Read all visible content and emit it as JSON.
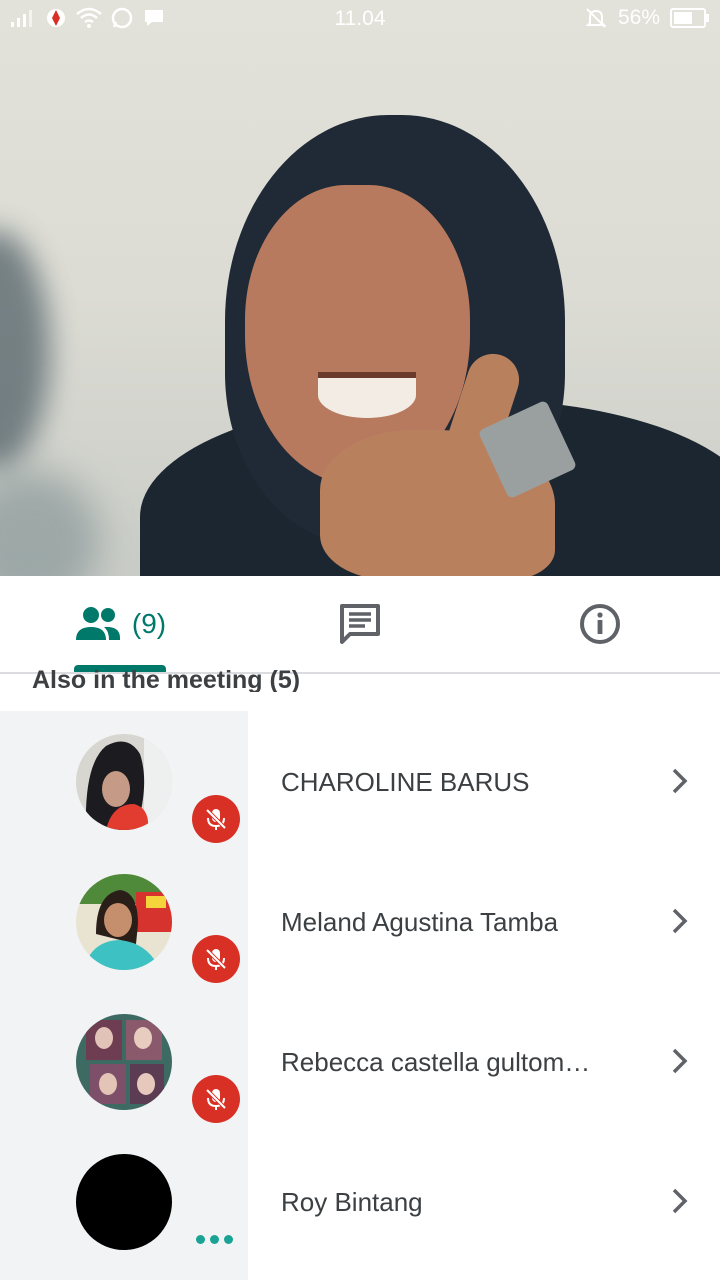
{
  "status_bar": {
    "time": "11.04",
    "battery": "56%",
    "icons": [
      "signal-icon",
      "telkom-icon",
      "wifi-icon",
      "whatsapp-icon",
      "chat-notification-icon",
      "mute-bell-icon",
      "battery-icon"
    ]
  },
  "video": {
    "description_icon": "participant-video"
  },
  "tabs": {
    "people_count": "(9)",
    "people_icon": "people-icon",
    "chat_icon": "chat-icon",
    "info_icon": "info-icon",
    "accent": "#00796b"
  },
  "section": {
    "title": "Also in the meeting (5)"
  },
  "participants": [
    {
      "name": "CHAROLINE BARUS",
      "status": "muted"
    },
    {
      "name": "Meland Agustina Tamba",
      "status": "muted"
    },
    {
      "name": "Rebecca castella gultom…",
      "status": "muted"
    },
    {
      "name": "Roy Bintang",
      "status": "speaking"
    }
  ],
  "colors": {
    "muted_badge": "#d93025",
    "speaking_dots": "#1aa394",
    "list_bg": "#f1f3f4"
  }
}
